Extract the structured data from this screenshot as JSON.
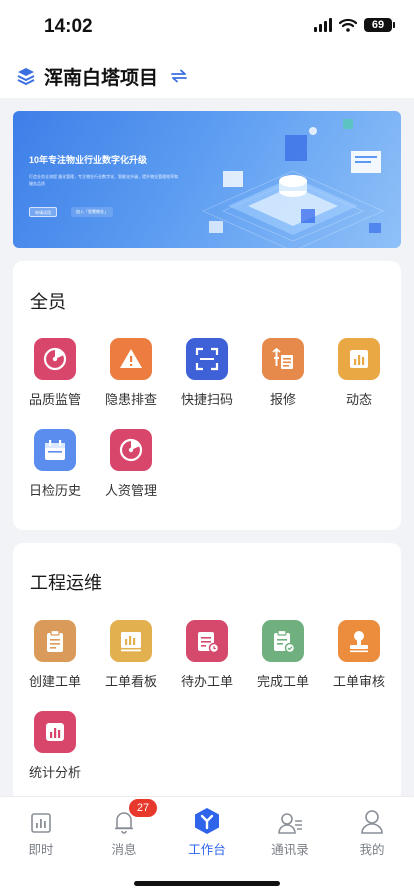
{
  "status_bar": {
    "time": "14:02",
    "battery": "69"
  },
  "header": {
    "project_name": "浑南白塔项目",
    "switch_icon": "swap-icon"
  },
  "banner": {
    "title": "10年专注物业行业数字化升级",
    "subtitle": "打造业务全流程 量化管理，专注物业行业数字化、智能化升级，提升物业管理效率和服务品质",
    "primary_btn": "申请试用",
    "secondary_btn": "加入「智慧物业」"
  },
  "section_all": {
    "title": "全员",
    "items": [
      {
        "label": "品质监管",
        "icon": "radar-icon",
        "color": "#d9466b"
      },
      {
        "label": "隐患排查",
        "icon": "warning-icon",
        "color": "#ec7c3f"
      },
      {
        "label": "快捷扫码",
        "icon": "scan-icon",
        "color": "#3f61d8"
      },
      {
        "label": "报修",
        "icon": "repair-icon",
        "color": "#e58a4a"
      },
      {
        "label": "动态",
        "icon": "chart-icon",
        "color": "#e9a844"
      },
      {
        "label": "日检历史",
        "icon": "calendar-icon",
        "color": "#5a8ded"
      },
      {
        "label": "人资管理",
        "icon": "radar-icon",
        "color": "#d9466b"
      }
    ]
  },
  "section_engineering": {
    "title": "工程运维",
    "items": [
      {
        "label": "创建工单",
        "icon": "clipboard-icon",
        "color": "#da9a5a"
      },
      {
        "label": "工单看板",
        "icon": "board-icon",
        "color": "#e3b04f"
      },
      {
        "label": "待办工单",
        "icon": "todo-icon",
        "color": "#d5496d"
      },
      {
        "label": "完成工单",
        "icon": "done-icon",
        "color": "#6fb07e"
      },
      {
        "label": "工单审核",
        "icon": "stamp-icon",
        "color": "#ec8c3d"
      },
      {
        "label": "统计分析",
        "icon": "stats-icon",
        "color": "#d9466b"
      }
    ]
  },
  "tabs": [
    {
      "label": "即时",
      "icon": "instant-icon"
    },
    {
      "label": "消息",
      "icon": "bell-icon",
      "badge": "27"
    },
    {
      "label": "工作台",
      "icon": "workbench-icon",
      "active": true
    },
    {
      "label": "通讯录",
      "icon": "contacts-icon"
    },
    {
      "label": "我的",
      "icon": "profile-icon"
    }
  ],
  "colors": {
    "accent": "#2e63ea",
    "badge": "#e8372b"
  }
}
